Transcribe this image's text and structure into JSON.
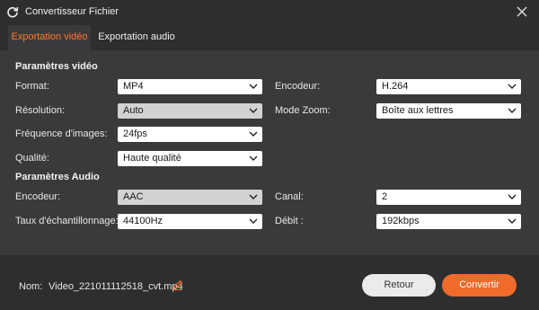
{
  "window": {
    "title": "Convertisseur Fichier"
  },
  "tabs": [
    {
      "label": "Exportation vidéo",
      "active": true
    },
    {
      "label": "Exportation audio",
      "active": false
    }
  ],
  "video": {
    "heading": "Paramètres vidéo",
    "format": {
      "label": "Format:",
      "value": "MP4"
    },
    "encoder": {
      "label": "Encodeur:",
      "value": "H.264"
    },
    "resolution": {
      "label": "Résolution:",
      "value": "Auto"
    },
    "zoom": {
      "label": "Mode Zoom:",
      "value": "Boîte aux lettres"
    },
    "framerate": {
      "label": "Fréquence d'images:",
      "value": "24fps"
    },
    "quality": {
      "label": "Qualité:",
      "value": "Haute qualité"
    }
  },
  "audio": {
    "heading": "Paramètres Audio",
    "encoder": {
      "label": "Encodeur:",
      "value": "AAC"
    },
    "channel": {
      "label": "Canal:",
      "value": "2"
    },
    "samplerate": {
      "label": "Taux d'échantillonnage:",
      "value": "44100Hz"
    },
    "bitrate": {
      "label": "Débit :",
      "value": "192kbps"
    }
  },
  "footer": {
    "name_label": "Nom:",
    "file_name": "Video_221011112518_cvt.mp4",
    "back_label": "Retour",
    "convert_label": "Convertir"
  },
  "colors": {
    "accent": "#f06a2a",
    "background": "#3a3a3c",
    "titlebar": "#2e2e2f"
  },
  "icons": [
    "app-refresh-icon",
    "close-icon",
    "chevron-down-icon",
    "edit-pencil-icon"
  ]
}
